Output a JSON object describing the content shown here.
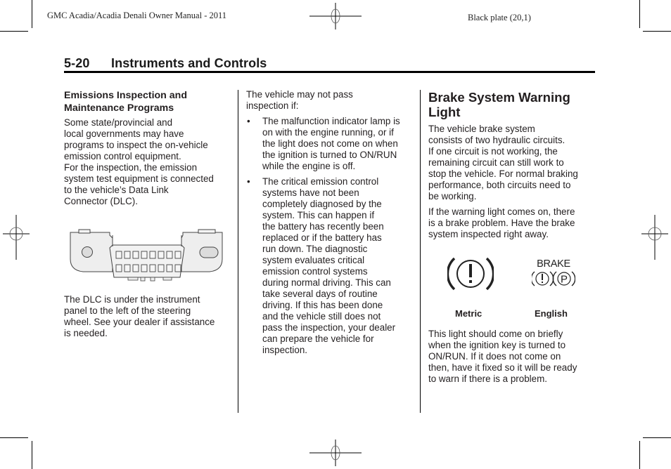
{
  "plate": {
    "left": "GMC Acadia/Acadia Denali Owner Manual - 2011",
    "right": "Black plate (20,1)"
  },
  "section": {
    "page_number": "5-20",
    "title": "Instruments and Controls"
  },
  "col1": {
    "heading_line1": "Emissions Inspection and",
    "heading_line2": "Maintenance Programs",
    "para1_lines": [
      "Some state/provincial and",
      "local governments may have",
      "programs to inspect the on-vehicle",
      "emission control equipment.",
      "For the inspection, the emission",
      "system test equipment is connected",
      "to the vehicle’s Data Link",
      "Connector (DLC)."
    ],
    "figure": {
      "icon": "dlc-connector-illustration"
    },
    "para2_lines": [
      "The DLC is under the instrument",
      "panel to the left of the steering",
      "wheel. See your dealer if assistance",
      "is needed."
    ]
  },
  "col2": {
    "intro_lines": [
      "The vehicle may not pass",
      "inspection if:"
    ],
    "bullet_glyph": "•",
    "bullets": [
      {
        "lines": [
          "The malfunction indicator lamp is",
          "on with the engine running, or if",
          "the light does not come on when",
          "the ignition is turned to ON/RUN",
          "while the engine is off."
        ]
      },
      {
        "lines": [
          "The critical emission control",
          "systems have not been",
          "completely diagnosed by the",
          "system. This can happen if",
          "the battery has recently been",
          "replaced or if the battery has",
          "run down. The diagnostic",
          "system evaluates critical",
          "emission control systems",
          "during normal driving. This can",
          "take several days of routine",
          "driving. If this has been done",
          "and the vehicle still does not",
          "pass the inspection, your dealer",
          "can prepare the vehicle for",
          "inspection."
        ]
      }
    ]
  },
  "col3": {
    "heading_line1": "Brake System Warning",
    "heading_line2": "Light",
    "para1_lines": [
      "The vehicle brake system",
      "consists of two hydraulic circuits.",
      "If one circuit is not working, the",
      "remaining circuit can still work to",
      "stop the vehicle. For normal braking",
      "performance, both circuits need to",
      "be working."
    ],
    "para2_lines": [
      "If the warning light comes on, there",
      "is a brake problem. Have the brake",
      "system inspected right away."
    ],
    "symbols": {
      "metric": {
        "icon": "brake-warning-metric-icon",
        "caption": "Metric"
      },
      "english": {
        "icon": "brake-warning-english-icon",
        "label": "BRAKE",
        "glyph1": "!",
        "glyph2": "P",
        "caption": "English"
      }
    },
    "para3_lines": [
      "This light should come on briefly",
      "when the ignition key is turned to",
      "ON/RUN. If it does not come on",
      "then, have it fixed so it will be ready",
      "to warn if there is a problem."
    ]
  }
}
